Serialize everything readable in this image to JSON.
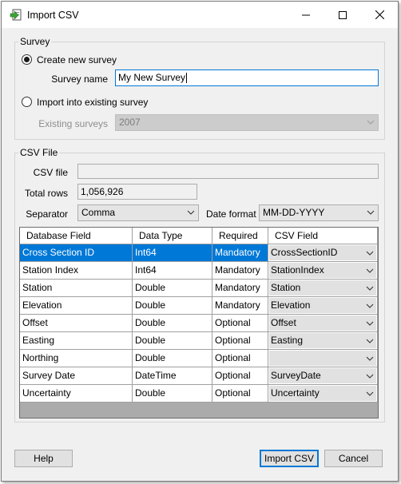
{
  "window": {
    "title": "Import CSV"
  },
  "survey": {
    "legend": "Survey",
    "create_new_label": "Create new survey",
    "survey_name_label": "Survey name",
    "survey_name_value": "My New Survey",
    "import_existing_label": "Import into existing survey",
    "existing_surveys_label": "Existing surveys",
    "existing_surveys_value": "2007"
  },
  "csv": {
    "legend": "CSV File",
    "csv_file_label": "CSV file",
    "csv_file_value": "",
    "total_rows_label": "Total rows",
    "total_rows_value": "1,056,926",
    "separator_label": "Separator",
    "separator_value": "Comma",
    "date_format_label": "Date format",
    "date_format_value": "MM-DD-YYYY"
  },
  "grid": {
    "headers": [
      "Database Field",
      "Data Type",
      "Required",
      "CSV Field"
    ],
    "rows": [
      {
        "field": "Cross Section ID",
        "type": "Int64",
        "required": "Mandatory",
        "csv": "CrossSectionID"
      },
      {
        "field": "Station Index",
        "type": "Int64",
        "required": "Mandatory",
        "csv": "StationIndex"
      },
      {
        "field": "Station",
        "type": "Double",
        "required": "Mandatory",
        "csv": "Station"
      },
      {
        "field": "Elevation",
        "type": "Double",
        "required": "Mandatory",
        "csv": "Elevation"
      },
      {
        "field": "Offset",
        "type": "Double",
        "required": "Optional",
        "csv": "Offset"
      },
      {
        "field": "Easting",
        "type": "Double",
        "required": "Optional",
        "csv": "Easting"
      },
      {
        "field": "Northing",
        "type": "Double",
        "required": "Optional",
        "csv": ""
      },
      {
        "field": "Survey Date",
        "type": "DateTime",
        "required": "Optional",
        "csv": "SurveyDate"
      },
      {
        "field": "Uncertainty",
        "type": "Double",
        "required": "Optional",
        "csv": "Uncertainty"
      }
    ]
  },
  "buttons": {
    "help": "Help",
    "import": "Import CSV",
    "cancel": "Cancel"
  },
  "colors": {
    "selection": "#0078d7",
    "focus_border": "#0078d7"
  }
}
